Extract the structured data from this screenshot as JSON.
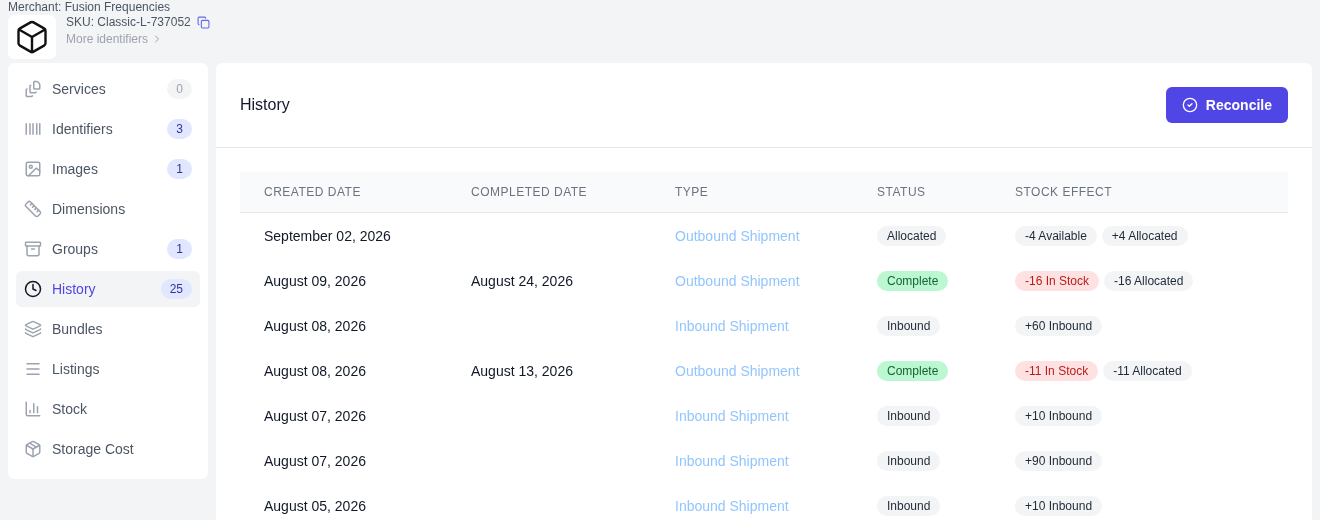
{
  "header": {
    "merchant": "Merchant: Fusion Frequencies",
    "sku": "SKU: Classic-L-737052",
    "more_link": "More identifiers"
  },
  "sidebar": {
    "items": [
      {
        "label": "Services",
        "count": "0",
        "highlighted": false,
        "selected": false
      },
      {
        "label": "Identifiers",
        "count": "3",
        "highlighted": true,
        "selected": false
      },
      {
        "label": "Images",
        "count": "1",
        "highlighted": true,
        "selected": false
      },
      {
        "label": "Dimensions",
        "selected": false
      },
      {
        "label": "Groups",
        "count": "1",
        "highlighted": true,
        "selected": false
      },
      {
        "label": "History",
        "count": "25",
        "highlighted": true,
        "selected": true
      },
      {
        "label": "Bundles",
        "selected": false
      },
      {
        "label": "Listings",
        "selected": false
      },
      {
        "label": "Stock",
        "selected": false
      },
      {
        "label": "Storage Cost",
        "selected": false
      }
    ]
  },
  "panel": {
    "title": "History",
    "action": "Reconcile"
  },
  "table": {
    "columns": [
      "CREATED DATE",
      "COMPLETED DATE",
      "TYPE",
      "STATUS",
      "STOCK EFFECT"
    ],
    "rows": [
      {
        "created": "September 02, 2026",
        "type": "Outbound Shipment",
        "status": {
          "label": "Allocated",
          "kind": "neutral"
        },
        "effects": [
          {
            "label": "-4 Available",
            "kind": "neutral"
          },
          {
            "label": "+4 Allocated",
            "kind": "neutral"
          }
        ]
      },
      {
        "created": "August 09, 2026",
        "completed": "August 24, 2026",
        "type": "Outbound Shipment",
        "status": {
          "label": "Complete",
          "kind": "success"
        },
        "effects": [
          {
            "label": "-16 In Stock",
            "kind": "danger"
          },
          {
            "label": "-16 Allocated",
            "kind": "neutral"
          }
        ]
      },
      {
        "created": "August 08, 2026",
        "type": "Inbound Shipment",
        "status": {
          "label": "Inbound",
          "kind": "neutral"
        },
        "effects": [
          {
            "label": "+60 Inbound",
            "kind": "neutral"
          }
        ]
      },
      {
        "created": "August 08, 2026",
        "completed": "August 13, 2026",
        "type": "Outbound Shipment",
        "status": {
          "label": "Complete",
          "kind": "success"
        },
        "effects": [
          {
            "label": "-11 In Stock",
            "kind": "danger"
          },
          {
            "label": "-11 Allocated",
            "kind": "neutral"
          }
        ]
      },
      {
        "created": "August 07, 2026",
        "type": "Inbound Shipment",
        "status": {
          "label": "Inbound",
          "kind": "neutral"
        },
        "effects": [
          {
            "label": "+10 Inbound",
            "kind": "neutral"
          }
        ]
      },
      {
        "created": "August 07, 2026",
        "type": "Inbound Shipment",
        "status": {
          "label": "Inbound",
          "kind": "neutral"
        },
        "effects": [
          {
            "label": "+90 Inbound",
            "kind": "neutral"
          }
        ]
      },
      {
        "created": "August 05, 2026",
        "type": "Inbound Shipment",
        "status": {
          "label": "Inbound",
          "kind": "neutral"
        },
        "effects": [
          {
            "label": "+10 Inbound",
            "kind": "neutral"
          }
        ]
      }
    ]
  }
}
